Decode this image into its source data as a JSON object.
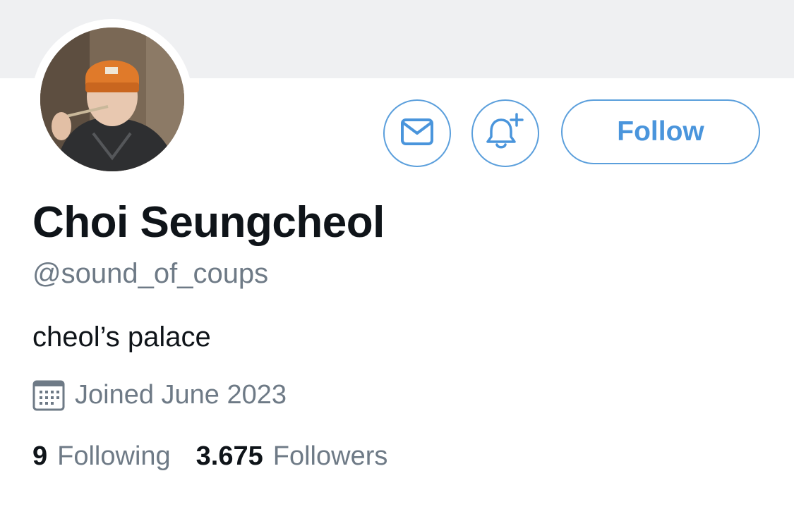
{
  "profile": {
    "display_name": "Choi Seungcheol",
    "handle": "@sound_of_coups",
    "bio": "cheol’s palace",
    "joined": "Joined June 2023"
  },
  "actions": {
    "message_icon": "envelope-icon",
    "notify_icon": "bell-plus-icon",
    "follow_label": "Follow"
  },
  "stats": {
    "following_count": "9",
    "following_label": "Following",
    "followers_count": "3.675",
    "followers_label": "Followers"
  },
  "colors": {
    "accent": "#4a95dc",
    "text_primary": "#0f1419",
    "text_secondary": "#6e7a86",
    "banner": "#eff0f2"
  }
}
